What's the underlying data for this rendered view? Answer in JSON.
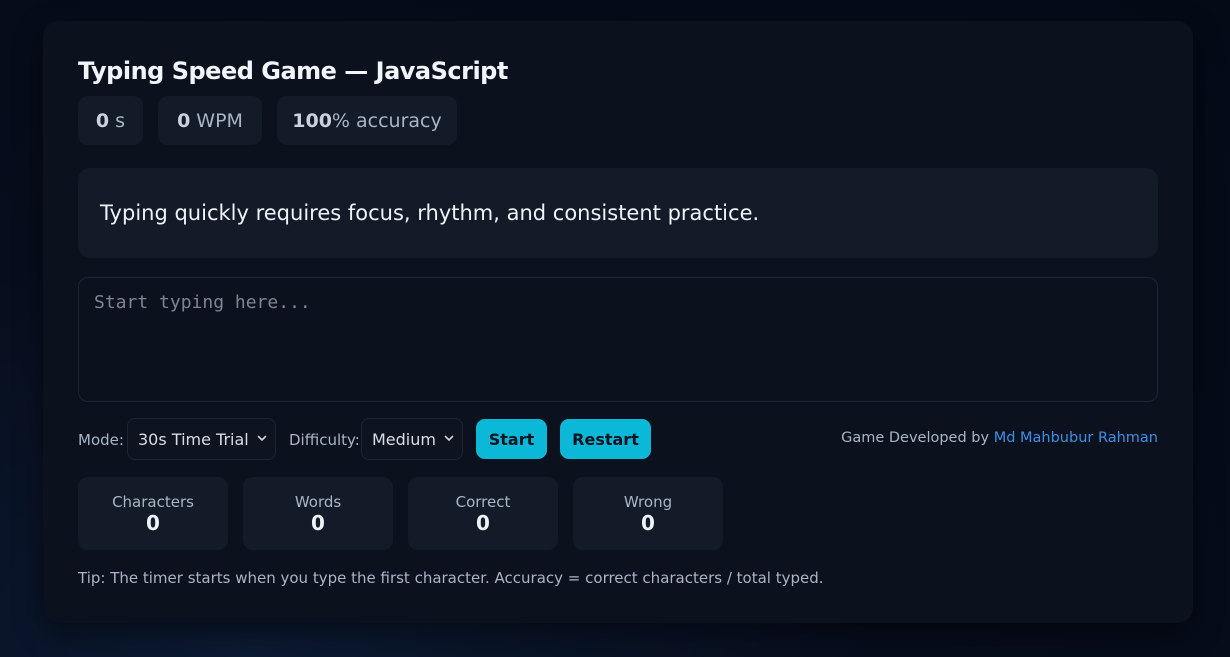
{
  "title": "Typing Speed Game — JavaScript",
  "stats": {
    "time_value": "0",
    "time_unit": "s",
    "wpm_value": "0",
    "wpm_unit": "WPM",
    "accuracy_value": "100",
    "accuracy_unit": "% accuracy"
  },
  "prompt_text": "Typing quickly requires focus, rhythm, and consistent practice.",
  "input": {
    "value": "",
    "placeholder": "Start typing here..."
  },
  "controls": {
    "mode_label": "Mode:",
    "mode_selected": "30s Time Trial",
    "difficulty_label": "Difficulty:",
    "difficulty_selected": "Medium",
    "start_label": "Start",
    "restart_label": "Restart"
  },
  "credit": {
    "prefix": "Game Developed by",
    "author": "Md Mahbubur Rahman"
  },
  "counters": [
    {
      "label": "Characters",
      "value": "0"
    },
    {
      "label": "Words",
      "value": "0"
    },
    {
      "label": "Correct",
      "value": "0"
    },
    {
      "label": "Wrong",
      "value": "0"
    }
  ],
  "tip": "Tip: The timer starts when you type the first character. Accuracy = correct characters / total typed.",
  "colors": {
    "accent": "#0cb8d8",
    "link": "#3d8ee6",
    "card": "#0b121e",
    "panel": "#141b28"
  }
}
